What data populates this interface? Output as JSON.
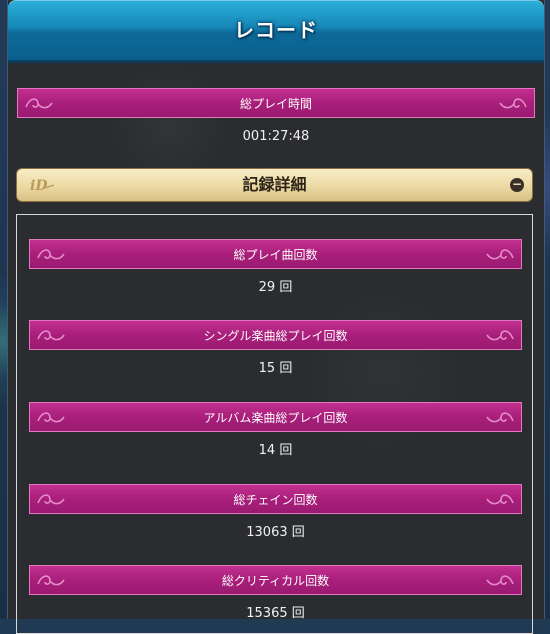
{
  "header": {
    "title": "レコード"
  },
  "total_play_time": {
    "label": "総プレイ時間",
    "value": "001:27:48"
  },
  "details": {
    "title": "記録詳細",
    "toggle_symbol": "−",
    "items": [
      {
        "label": "総プレイ曲回数",
        "value": "29 回"
      },
      {
        "label": "シングル楽曲総プレイ回数",
        "value": "15 回"
      },
      {
        "label": "アルバム楽曲総プレイ回数",
        "value": "14 回"
      },
      {
        "label": "総チェイン回数",
        "value": "13063 回"
      },
      {
        "label": "総クリティカル回数",
        "value": "15365 回"
      }
    ]
  },
  "colors": {
    "header": "#1687b8",
    "bar": "#a91f7b",
    "accordion": "#ecd9a3",
    "panel": "#2a2c2f"
  }
}
